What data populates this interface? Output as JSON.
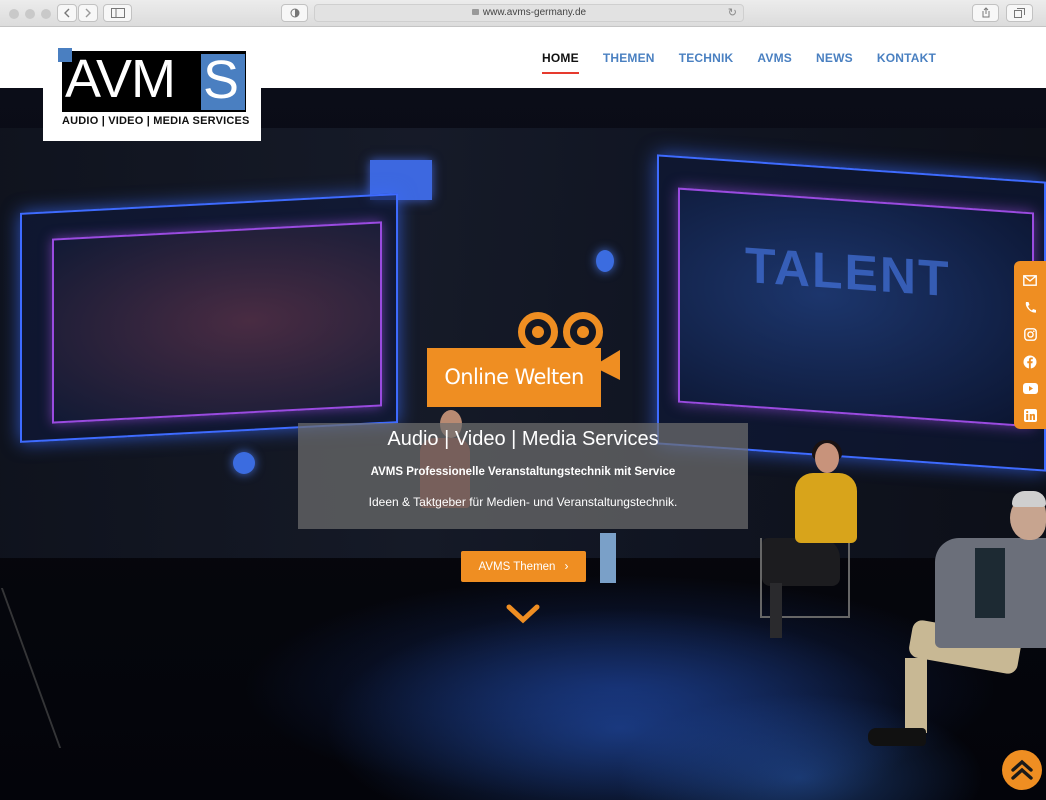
{
  "browser": {
    "url": "www.avms-germany.de"
  },
  "logo": {
    "letters": "AVM",
    "letter_s": "S",
    "tagline": "AUDIO | VIDEO | MEDIA SERVICES"
  },
  "nav": {
    "items": [
      {
        "label": "HOME",
        "active": true
      },
      {
        "label": "THEMEN",
        "active": false
      },
      {
        "label": "TECHNIK",
        "active": false
      },
      {
        "label": "AVMS",
        "active": false
      },
      {
        "label": "NEWS",
        "active": false
      },
      {
        "label": "KONTAKT",
        "active": false
      }
    ]
  },
  "hero": {
    "badge_label": "Online Welten",
    "title": "Audio | Video | Media Services",
    "subtitle": "AVMS Professionelle Veranstaltungstechnik mit Service",
    "text": "Ideen & Taktgeber für Medien- und Veranstaltungstechnik.",
    "cta_label": "AVMS Themen",
    "screen_word": "TALENT"
  },
  "social": {
    "icons": [
      "mail-icon",
      "phone-icon",
      "instagram-icon",
      "facebook-icon",
      "youtube-icon",
      "linkedin-icon"
    ]
  },
  "colors": {
    "accent": "#ef8e22",
    "nav_link": "#4a80c1",
    "nav_active_underline": "#e63a2e",
    "logo_blue": "#4a7fc1"
  }
}
